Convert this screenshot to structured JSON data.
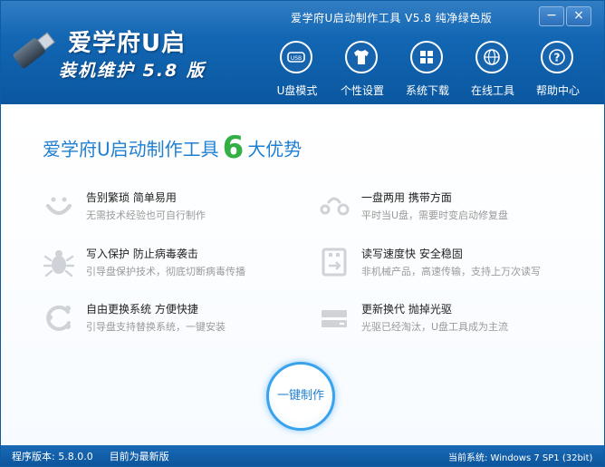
{
  "window": {
    "title": "爱学府U启动制作工具 V5.8 纯净绿色版",
    "minimize_label": "−",
    "close_label": "×"
  },
  "brand": {
    "name": "爱学府U启",
    "subtitle": "装机维护 5.8 版"
  },
  "nav": {
    "items": [
      {
        "label": "U盘模式",
        "icon": "usb-icon"
      },
      {
        "label": "个性设置",
        "icon": "shirt-icon"
      },
      {
        "label": "系统下载",
        "icon": "windows-icon"
      },
      {
        "label": "在线工具",
        "icon": "globe-icon"
      },
      {
        "label": "帮助中心",
        "icon": "help-icon"
      }
    ]
  },
  "headline": {
    "part1": "爱学府U启动制作工具",
    "number": "6",
    "part2": "大优势"
  },
  "features": [
    {
      "title": "告别繁琐 简单易用",
      "desc": "无需技术经验也可自行制作",
      "icon": "smile-icon"
    },
    {
      "title": "写入保护 防止病毒袭击",
      "desc": "引导盘保护技术，彻底切断病毒传播",
      "icon": "bug-icon"
    },
    {
      "title": "自由更换系统 方便快捷",
      "desc": "引导盘支持替换系统，一键安装",
      "icon": "refresh-icon"
    },
    {
      "title": "一盘两用 携带方面",
      "desc": "平时当U盘，需要时变启动修复盘",
      "icon": "toggle-icon"
    },
    {
      "title": "读写速度快 安全稳固",
      "desc": "非机械产品，高速传输，支持上万次读写",
      "icon": "usb-drive-icon"
    },
    {
      "title": "更新换代 抛掉光驱",
      "desc": "光驱已经淘汰，U盘工具成为主流",
      "icon": "disc-drive-icon"
    }
  ],
  "action": {
    "make_label": "一键制作"
  },
  "status": {
    "version_label": "程序版本: 5.8.0.0",
    "update_label": "目前为最新版",
    "system_label": "当前系统: Windows 7 SP1 (32bit)"
  },
  "colors": {
    "header_blue": "#1164b0",
    "accent_blue": "#1f7fd1",
    "accent_green": "#33b043",
    "desc_gray": "#9a9a9a"
  }
}
